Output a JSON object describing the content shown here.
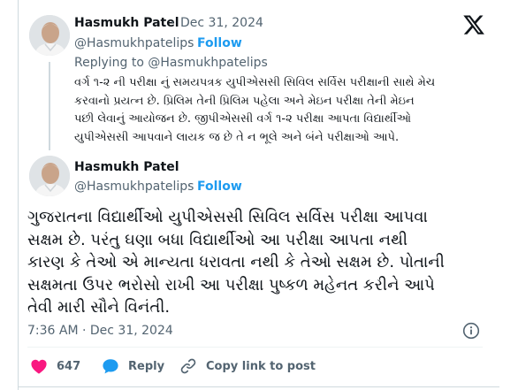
{
  "reply_tweet": {
    "author_name": "Hasmukh Patel",
    "sep": "·",
    "date": "Dec 31, 2024",
    "handle": "@Hasmukhpatelips",
    "follow_sep": "·",
    "follow_label": "Follow",
    "replying_to": "Replying to @Hasmukhpatelips",
    "lines": [
      "વર્ગ ૧-૨ ની પરીક્ષા નું સમયપત્રક યુપીએસસી સિવિલ સર્વિસ પરીક્ષાની સાથે મેચ",
      "કરવાનો પ્રયત્ન છે.  પ્રિલિમ તેની પ્રિલિમ પહેલા અને મેઇન પરીક્ષા તેની મેઇન",
      "પછી લેવાનું આયોજન છે. જીપીએસસી વર્ગ ૧-૨ પરીક્ષા આપતા વિદ્યાર્થીઓ",
      "યુપીએસસી આપવાને લાયક જ છે તે ન ભૂલે અને બંને પરીક્ષાઓ આપે."
    ]
  },
  "main_tweet": {
    "author_name": "Hasmukh Patel",
    "handle": "@Hasmukhpatelips",
    "follow_sep": "·",
    "follow_label": "Follow",
    "lines": [
      "ગુજરાતના વિદ્યાર્થીઓ યુપીએસસી સિવિલ સર્વિસ પરીક્ષા આપવા",
      "સક્ષમ છે. પરંતુ ઘણા બધા વિદ્યાર્થીઓ આ પરીક્ષા આપતા નથી",
      "કારણ કે તેઓ એ માન્યતા ધરાવતા નથી કે તેઓ સક્ષમ છે. પોતાની",
      "સક્ષમતા ઉપર ભરોસો રાખી આ પરીક્ષા પુષ્કળ મહેનત કરીને આપે",
      "તેવી મારી સૌને વિનંતી."
    ],
    "timestamp": "7:36 AM · Dec 31, 2024"
  },
  "actions": {
    "like_count": "647",
    "reply_label": "Reply",
    "copy_label": "Copy link to post"
  },
  "icons": {
    "x_logo": "x-logo-icon",
    "info": "info-icon",
    "heart": "heart-icon",
    "reply": "reply-bubble-icon",
    "link": "link-icon"
  },
  "colors": {
    "like": "#f91880",
    "reply": "#1d9bf0",
    "follow": "#1d9bf0",
    "muted": "#536471"
  }
}
